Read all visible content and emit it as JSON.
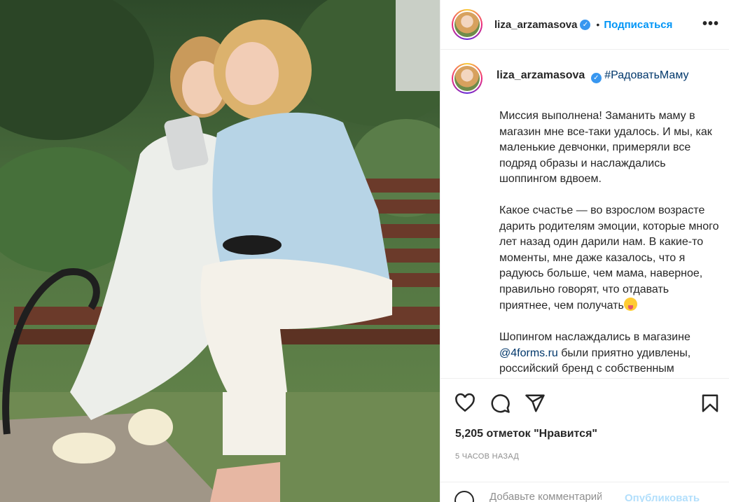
{
  "post": {
    "username": "liza_arzamasova",
    "follow_label": "Подписаться",
    "separator": "•",
    "more_label": "•••"
  },
  "caption": {
    "username": "liza_arzamasova",
    "hashtag": "#РадоватьМаму",
    "paragraph1": "Миссия выполнена! Заманить маму в магазин мне все-таки удалось. И мы, как маленькие девчонки, примеряли все подряд образы и наслаждались шоппингом вдвоем.",
    "paragraph2": "Какое счастье — во взрослом возрасте дарить родителям эмоции, которые много лет назад один дарили нам. В какие-то моменты, мне даже казалось, что я радуюсь больше, чем мама, наверное, правильно говорят, что отдавать приятнее, чем получать",
    "paragraph3_start": "Шопингом наслаждались в магазине",
    "mention": "@4forms.ru",
    "paragraph3_end": "были приятно удивлены, российский бренд с собственным"
  },
  "stats": {
    "likes": "5,205 отметок \"Нравится\"",
    "time": "5 ЧАСОВ НАЗАД"
  },
  "comment_box": {
    "placeholder": "Добавьте комментарий...",
    "publish_label": "Опубликовать"
  },
  "icons": [
    "heart-icon",
    "comment-icon",
    "share-icon",
    "bookmark-icon",
    "verified-icon",
    "emoji-icon",
    "more-icon"
  ],
  "colors": {
    "link": "#0095f6",
    "hashtag": "#00376b",
    "muted": "#8e8e8e",
    "verified": "#3897f0"
  }
}
